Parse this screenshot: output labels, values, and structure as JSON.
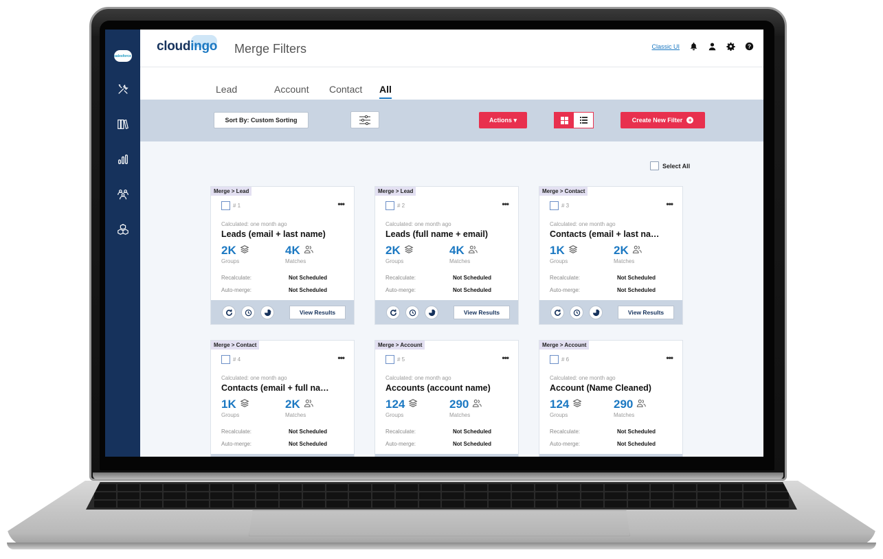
{
  "app": {
    "logo": "cloud",
    "logo_accent": "ingo",
    "page_title": "Merge Filters",
    "sidebar_brand": "salesforce"
  },
  "header": {
    "classic_link": "Classic UI"
  },
  "tabs": [
    {
      "label": "Lead",
      "active": false
    },
    {
      "label": "Account",
      "active": false
    },
    {
      "label": "Contact",
      "active": false
    },
    {
      "label": "All",
      "active": true
    }
  ],
  "toolbar": {
    "sort_label": "Sort By: Custom Sorting",
    "actions_label": "Actions ▾",
    "create_label": "Create New Filter"
  },
  "select_all_label": "Select All",
  "labels": {
    "groups": "Groups",
    "matches": "Matches",
    "recalculate": "Recalculate:",
    "auto_merge": "Auto-merge:",
    "view_results": "View Results"
  },
  "cards": [
    {
      "tag": "Merge > Lead",
      "num": "# 1",
      "calculated": "Calculated: one month ago",
      "title": "Leads (email + last name)",
      "groups": "2K",
      "matches": "4K",
      "recalculate": "Not Scheduled",
      "auto_merge": "Not Scheduled"
    },
    {
      "tag": "Merge > Lead",
      "num": "# 2",
      "calculated": "Calculated: one month ago",
      "title": "Leads (full name + email)",
      "groups": "2K",
      "matches": "4K",
      "recalculate": "Not Scheduled",
      "auto_merge": "Not Scheduled"
    },
    {
      "tag": "Merge > Contact",
      "num": "# 3",
      "calculated": "Calculated: one month ago",
      "title": "Contacts (email + last na…",
      "groups": "1K",
      "matches": "2K",
      "recalculate": "Not Scheduled",
      "auto_merge": "Not Scheduled"
    },
    {
      "tag": "Merge > Contact",
      "num": "# 4",
      "calculated": "Calculated: one month ago",
      "title": "Contacts (email + full na…",
      "groups": "1K",
      "matches": "2K",
      "recalculate": "Not Scheduled",
      "auto_merge": "Not Scheduled"
    },
    {
      "tag": "Merge > Account",
      "num": "# 5",
      "calculated": "Calculated: one month ago",
      "title": "Accounts (account name)",
      "groups": "124",
      "matches": "290",
      "recalculate": "Not Scheduled",
      "auto_merge": "Not Scheduled"
    },
    {
      "tag": "Merge > Account",
      "num": "# 6",
      "calculated": "Calculated: one month ago",
      "title": "Account (Name Cleaned)",
      "groups": "124",
      "matches": "290",
      "recalculate": "Not Scheduled",
      "auto_merge": "Not Scheduled"
    }
  ],
  "colors": {
    "sidebar": "#16325c",
    "accent_red": "#e8304e",
    "link_blue": "#1b78c2",
    "toolbar_bg": "#c9d4e2"
  }
}
